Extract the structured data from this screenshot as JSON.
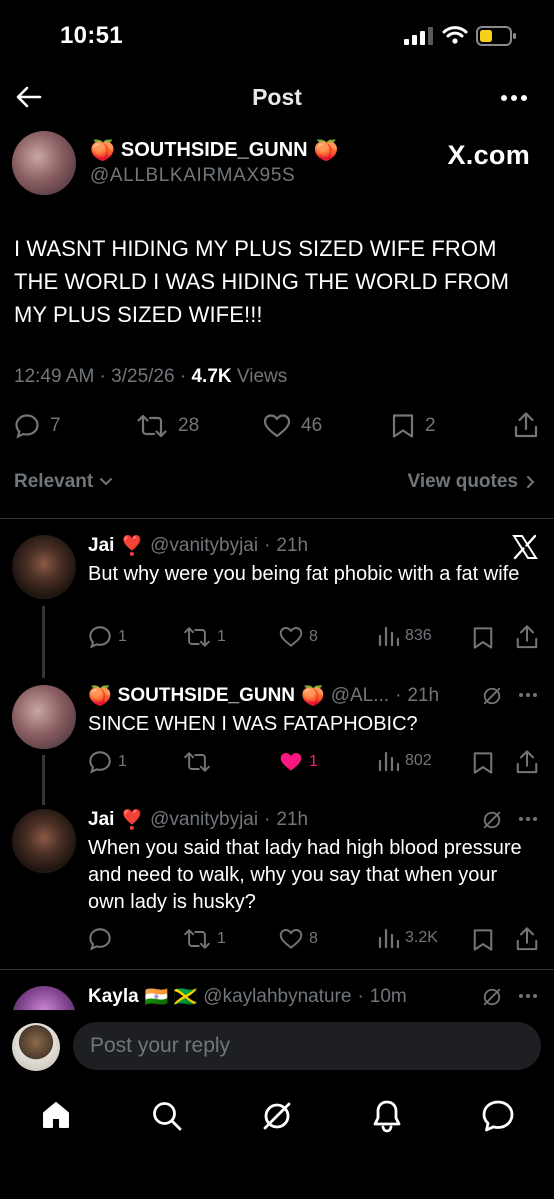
{
  "status_bar": {
    "time": "10:51"
  },
  "header": {
    "title": "Post"
  },
  "post": {
    "author_name": "SOUTHSIDE_GUNN",
    "author_handle": "@ALLBLKAIRMAX95S",
    "badge": "X.com",
    "text": "I WASNT HIDING MY PLUS SIZED WIFE FROM THE WORLD I WAS HIDING THE WORLD FROM MY PLUS SIZED WIFE!!!",
    "time": "12:49 AM",
    "date": "3/25/26",
    "views_count": "4.7K",
    "views_label": "Views",
    "replies": "7",
    "reposts": "28",
    "likes": "46",
    "bookmarks": "2"
  },
  "filters": {
    "sort_label": "Relevant",
    "quotes_label": "View quotes"
  },
  "replies": [
    {
      "name": "Jai",
      "handle": "@vanitybyjai",
      "time": "21h",
      "text": "But why were you being fat phobic with a fat wife",
      "replies": "1",
      "reposts": "1",
      "likes": "8",
      "views": "836"
    },
    {
      "name": "SOUTHSIDE_GUNN",
      "handle": "@AL...",
      "time": "21h",
      "text": "SINCE WHEN I WAS FATAPHOBIC?",
      "replies": "1",
      "reposts": "",
      "likes": "1",
      "views": "802",
      "liked": true
    },
    {
      "name": "Jai",
      "handle": "@vanitybyjai",
      "time": "21h",
      "text": "When you said that lady had high blood pressure and need to walk, why you say that when your own lady is husky?",
      "replies": "",
      "reposts": "1",
      "likes": "8",
      "views": "3.2K"
    },
    {
      "name": "Kayla",
      "handle": "@kaylahbynature",
      "time": "10m",
      "flags": "🇮🇳 🇯🇲"
    }
  ],
  "reply_box": {
    "placeholder": "Post your reply"
  },
  "colors": {
    "background": "#000000",
    "text": "#e7e9ea",
    "muted": "#71767b",
    "like": "#f91880",
    "divider": "#2f3336"
  }
}
